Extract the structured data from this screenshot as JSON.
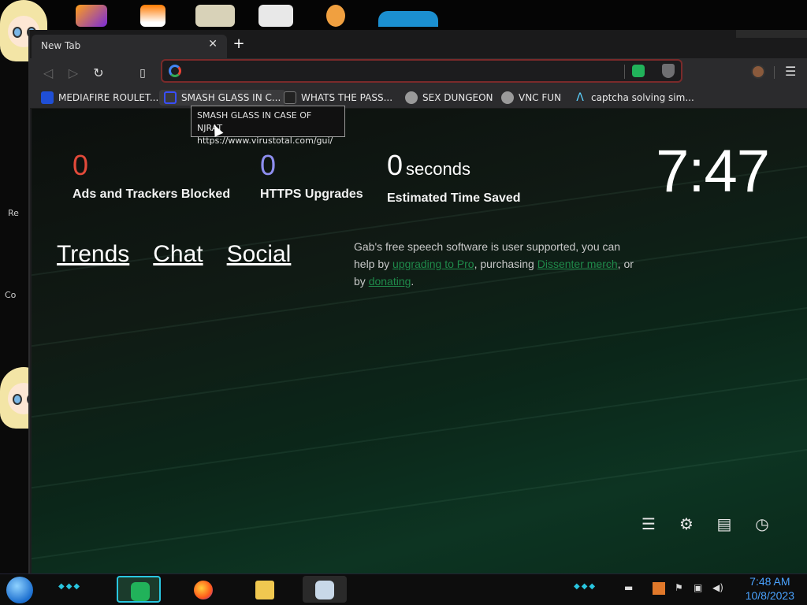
{
  "browser": {
    "tab": {
      "title": "New Tab",
      "close_label": "✕"
    },
    "new_tab_label": "+",
    "omnibox": {
      "placeholder": "",
      "value": ""
    },
    "bookmarks": [
      {
        "label": "MEDIAFIRE ROULET...",
        "icon": "mediafire-icon",
        "color": "#1f4fd6"
      },
      {
        "label": "SMASH GLASS IN C...",
        "icon": "virustotal-icon",
        "color": "#394eff"
      },
      {
        "label": "WHATS THE PASS...",
        "icon": "hacker-icon",
        "color": "#222222"
      },
      {
        "label": "SEX DUNGEON",
        "icon": "skull-icon",
        "color": "#9a9a9a"
      },
      {
        "label": "VNC FUN",
        "icon": "skull-icon",
        "color": "#9a9a9a"
      },
      {
        "label": "captcha solving sim...",
        "icon": "lambda-icon",
        "color": "#5ad1ff"
      }
    ],
    "tooltip": {
      "title": "SMASH GLASS IN CASE OF NJRAT",
      "url": "https://www.virustotal.com/gui/"
    }
  },
  "ntp": {
    "stats": [
      {
        "value": "0",
        "unit": "",
        "label": "Ads and Trackers Blocked",
        "color": "#e24a3a"
      },
      {
        "value": "0",
        "unit": "",
        "label": "HTTPS Upgrades",
        "color": "#8e8eef"
      },
      {
        "value": "0",
        "unit": "seconds",
        "label": "Estimated Time Saved",
        "color": "#ffffff"
      }
    ],
    "clock": "7:47",
    "links": [
      "Trends",
      "Chat",
      "Social"
    ],
    "gab_note": {
      "prefix": "Gab's free speech software is user supported, you can help by ",
      "link1": "upgrading to Pro",
      "mid": ", purchasing ",
      "link2": "Dissenter merch",
      "mid2": ", or by ",
      "link3": "donating",
      "suffix": "."
    },
    "corner_icons": [
      "sliders-icon",
      "gear-icon",
      "bookmarks-icon",
      "history-icon"
    ]
  },
  "desktop": {
    "side_labels": [
      "Re",
      "Co"
    ]
  },
  "taskbar": {
    "time": "7:48 AM",
    "date": "10/8/2023"
  },
  "colors": {
    "accent_green": "#21b25a",
    "link_green": "#1f8a4a",
    "ads_red": "#e24a3a",
    "https_purple": "#8e8eef",
    "taskbar_time": "#4aa3ff"
  }
}
